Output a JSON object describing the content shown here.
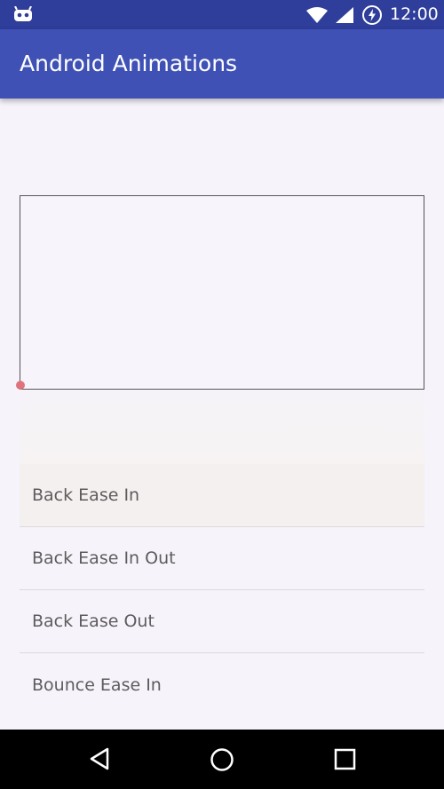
{
  "status_bar": {
    "time": "12:00",
    "icons": [
      "android-icon",
      "wifi-icon",
      "signal-icon",
      "battery-icon"
    ]
  },
  "app_bar": {
    "title": "Android Animations"
  },
  "animation_list": {
    "items": [
      {
        "label": "Back Ease In"
      },
      {
        "label": "Back Ease In Out"
      },
      {
        "label": "Back Ease Out"
      },
      {
        "label": "Bounce Ease In"
      }
    ]
  },
  "nav_bar": {
    "icons": [
      "back-icon",
      "home-icon",
      "recents-icon"
    ]
  },
  "colors": {
    "primary": "#3f51b5",
    "primary_dark": "#2f3d9b",
    "dot": "#e0727c"
  }
}
